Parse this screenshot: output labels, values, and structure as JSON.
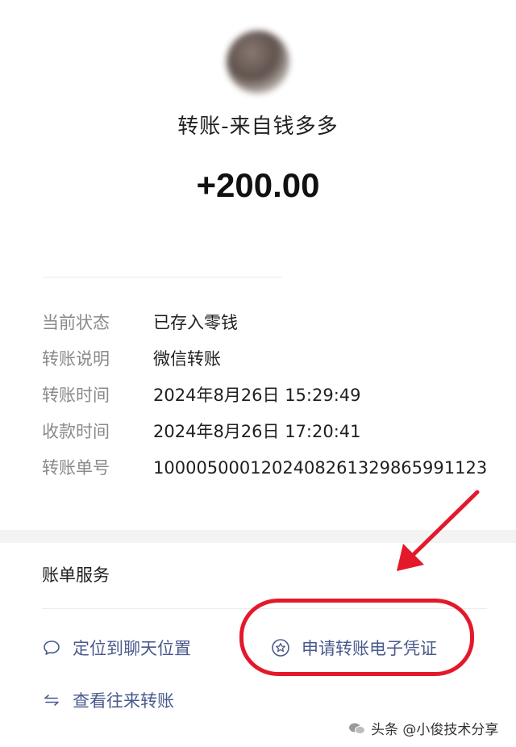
{
  "header": {
    "title": "转账-来自钱多多",
    "amount": "+200.00"
  },
  "details": [
    {
      "label": "当前状态",
      "value": "已存入零钱"
    },
    {
      "label": "转账说明",
      "value": "微信转账"
    },
    {
      "label": "转账时间",
      "value": "2024年8月26日 15:29:49"
    },
    {
      "label": "收款时间",
      "value": "2024年8月26日 17:20:41"
    },
    {
      "label": "转账单号",
      "value": "1000050001202408261329865991123"
    }
  ],
  "services": {
    "title": "账单服务",
    "locate_chat": {
      "label": "定位到聊天位置",
      "icon": "chat-bubble-icon"
    },
    "apply_voucher": {
      "label": "申请转账电子凭证",
      "icon": "star-circle-icon"
    },
    "view_transfers": {
      "label": "查看往来转账",
      "icon": "swap-arrows-icon"
    }
  },
  "watermark": {
    "text": "头条 @小俊技术分享"
  },
  "colors": {
    "link": "#4a5a8c",
    "annotation": "#e3192b",
    "label": "#8a8a8a"
  }
}
